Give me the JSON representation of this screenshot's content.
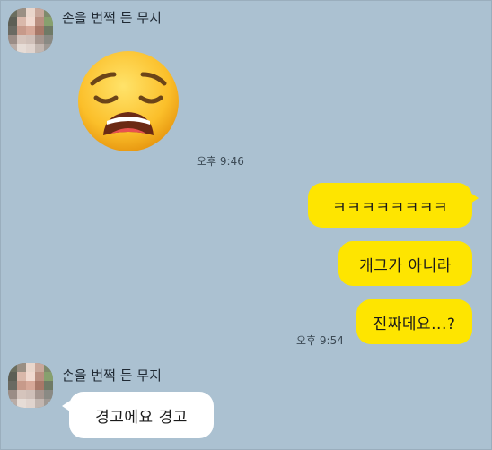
{
  "chat": {
    "sender_name": "손을 번쩍 든 무지",
    "sticker_name": "weary-face-emoji",
    "sticker_time": "오후 9:46",
    "my_messages": [
      "ㅋㅋㅋㅋㅋㅋㅋㅋ",
      "개그가 아니라",
      "진짜데요...?"
    ],
    "my_time": "오후 9:54",
    "second_sender_name": "손을 번쩍 든 무지",
    "reply_message": "경고에요 경고"
  },
  "colors": {
    "background": "#abc1d1",
    "my_bubble": "#fee500",
    "other_bubble": "#ffffff"
  }
}
